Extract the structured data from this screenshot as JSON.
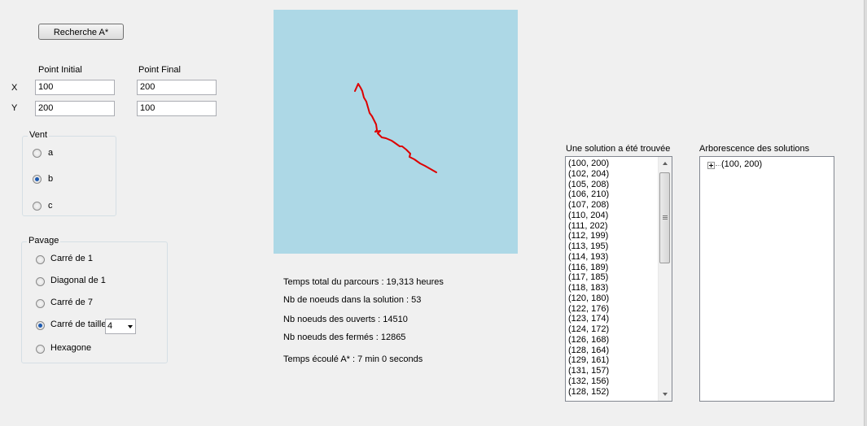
{
  "search_button": "Recherche A*",
  "points": {
    "initial_label": "Point Initial",
    "final_label": "Point Final",
    "x_label": "X",
    "y_label": "Y",
    "initial_x": "100",
    "initial_y": "200",
    "final_x": "200",
    "final_y": "100"
  },
  "vent": {
    "title": "Vent",
    "options": [
      "a",
      "b",
      "c"
    ],
    "selected": "b"
  },
  "pavage": {
    "title": "Pavage",
    "options": [
      "Carré de 1",
      "Diagonal de 1",
      "Carré de 7",
      "Carré de taille",
      "Hexagone"
    ],
    "selected": "Carré de taille",
    "size_value": "4"
  },
  "map": {
    "background": "#add8e6",
    "path_color": "#dd0000"
  },
  "stats": {
    "total_time": "Temps total du parcours : 19,313 heures",
    "nodes_solution": "Nb de noeuds dans la solution : 53",
    "nodes_open": "Nb noeuds des ouverts : 14510",
    "nodes_closed": "Nb noeuds des fermés : 12865",
    "elapsed": "Temps écoulé A* : 7 min 0 seconds"
  },
  "solution": {
    "title": "Une solution a été trouvée",
    "items": [
      "(100, 200)",
      "(102, 204)",
      "(105, 208)",
      "(106, 210)",
      "(107, 208)",
      "(110, 204)",
      "(111, 202)",
      "(112, 199)",
      "(113, 195)",
      "(114, 193)",
      "(116, 189)",
      "(117, 185)",
      "(118, 183)",
      "(120, 180)",
      "(122, 176)",
      "(123, 174)",
      "(124, 172)",
      "(126, 168)",
      "(128, 164)",
      "(129, 161)",
      "(131, 157)",
      "(132, 156)",
      "(128, 152)"
    ]
  },
  "tree": {
    "title": "Arborescence des solutions",
    "root": "(100, 200)"
  }
}
